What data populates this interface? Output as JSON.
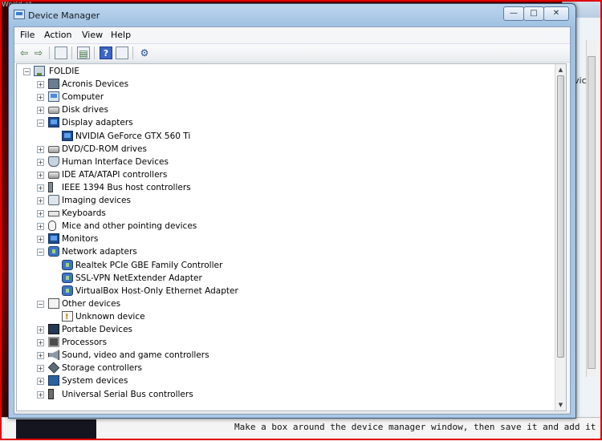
{
  "background": {
    "left_window_text": "World of",
    "browser_side_text": "vice",
    "bottom_text": "Make a box around the device manager window, then save it and add it as an",
    "frame_color": "#e00000"
  },
  "window": {
    "title": "Device Manager",
    "caption_buttons": {
      "minimize": "—",
      "maximize": "□",
      "close": "✕"
    }
  },
  "menu": {
    "file": "File",
    "action": "Action",
    "view": "View",
    "help": "Help"
  },
  "toolbar": {
    "back_icon": "⇦",
    "forward_icon": "⇨",
    "help_icon": "?",
    "properties_icon": "▤",
    "scan_icon": "⚙"
  },
  "tree": {
    "root": "FOLDIE",
    "categories": [
      {
        "label": "Acronis Devices",
        "icon": "chip-icon",
        "expanded": false
      },
      {
        "label": "Computer",
        "icon": "computer-icon",
        "expanded": false
      },
      {
        "label": "Disk drives",
        "icon": "disk-icon",
        "expanded": false
      },
      {
        "label": "Display adapters",
        "icon": "monitor-icon",
        "expanded": true,
        "children": [
          "NVIDIA GeForce GTX 560 Ti"
        ]
      },
      {
        "label": "DVD/CD-ROM drives",
        "icon": "disk-icon",
        "expanded": false
      },
      {
        "label": "Human Interface Devices",
        "icon": "hid-icon",
        "expanded": false
      },
      {
        "label": "IDE ATA/ATAPI controllers",
        "icon": "disk-icon",
        "expanded": false
      },
      {
        "label": "IEEE 1394 Bus host controllers",
        "icon": "plug-icon",
        "expanded": false
      },
      {
        "label": "Imaging devices",
        "icon": "camera-icon",
        "expanded": false
      },
      {
        "label": "Keyboards",
        "icon": "keyboard-icon",
        "expanded": false
      },
      {
        "label": "Mice and other pointing devices",
        "icon": "mouse-icon",
        "expanded": false
      },
      {
        "label": "Monitors",
        "icon": "monitor-icon",
        "expanded": false
      },
      {
        "label": "Network adapters",
        "icon": "network-icon",
        "expanded": true,
        "children": [
          "Realtek PCIe GBE Family Controller",
          "SSL-VPN NetExtender Adapter",
          "VirtualBox Host-Only Ethernet Adapter"
        ]
      },
      {
        "label": "Other devices",
        "icon": "other-icon",
        "expanded": true,
        "children": [
          "Unknown device"
        ]
      },
      {
        "label": "Portable Devices",
        "icon": "portable-icon",
        "expanded": false
      },
      {
        "label": "Processors",
        "icon": "cpu-icon",
        "expanded": false
      },
      {
        "label": "Sound, video and game controllers",
        "icon": "sound-icon",
        "expanded": false
      },
      {
        "label": "Storage controllers",
        "icon": "storage-icon",
        "expanded": false
      },
      {
        "label": "System devices",
        "icon": "system-icon",
        "expanded": false
      },
      {
        "label": "Universal Serial Bus controllers",
        "icon": "usb-icon",
        "expanded": false
      }
    ]
  }
}
